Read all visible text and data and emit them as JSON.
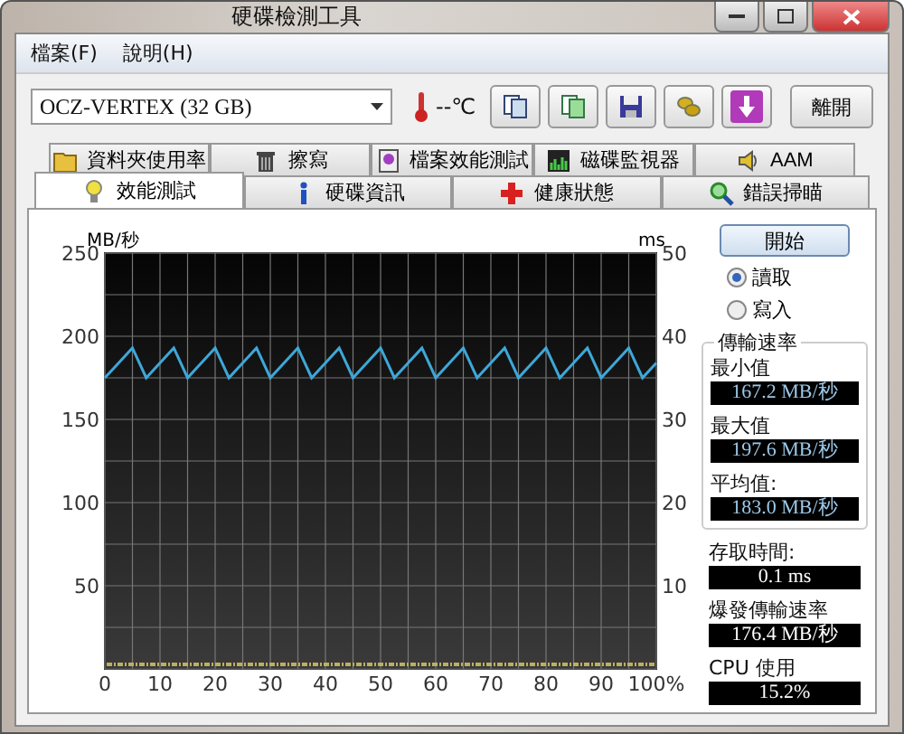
{
  "window": {
    "title": "硬碟檢測工具"
  },
  "menu": [
    {
      "label": "檔案(F)"
    },
    {
      "label": "說明(H)"
    }
  ],
  "toolbar": {
    "drive": "OCZ-VERTEX (32 GB)",
    "temperature": "--℃",
    "exit_button": "離開"
  },
  "tab_rows": [
    {
      "tabs": [
        {
          "label": "資料夾使用率",
          "kind": "folder",
          "selected": false
        },
        {
          "label": "擦寫",
          "kind": "trash",
          "selected": false
        },
        {
          "label": "檔案效能測試",
          "kind": "file",
          "selected": false
        },
        {
          "label": "磁碟監視器",
          "kind": "monitor",
          "selected": false
        },
        {
          "label": "AAM",
          "kind": "speaker",
          "selected": false
        }
      ]
    },
    {
      "tabs": [
        {
          "label": "效能測試",
          "kind": "bulb",
          "selected": true
        },
        {
          "label": "硬碟資訊",
          "kind": "info",
          "selected": false
        },
        {
          "label": "健康狀態",
          "kind": "health",
          "selected": false
        },
        {
          "label": "錯誤掃瞄",
          "kind": "search",
          "selected": false
        }
      ]
    }
  ],
  "benchmark": {
    "chart_data": {
      "type": "line",
      "ylabel": "MB/秒",
      "x": [
        0,
        2.5,
        5,
        7.5,
        10,
        12.5,
        15,
        17.5,
        20,
        22.5,
        25,
        27.5,
        30,
        32.5,
        35,
        37.5,
        40,
        42.5,
        45,
        47.5,
        50,
        52.5,
        55,
        57.5,
        60,
        62.5,
        65,
        67.5,
        70,
        72.5,
        75,
        77.5,
        80,
        82.5,
        85,
        87.5,
        90,
        92.5,
        95,
        97.5,
        100
      ],
      "series": [
        {
          "color": "#3ea7d8",
          "values": [
            175,
            184,
            193,
            175,
            184,
            193,
            175,
            184,
            193,
            175,
            184,
            193,
            175,
            184,
            193,
            175,
            184,
            193,
            175,
            184,
            193,
            175,
            184,
            193,
            175,
            184,
            193,
            175,
            184,
            193,
            175,
            184,
            193,
            175,
            184,
            193,
            175,
            184,
            193,
            175,
            184
          ]
        }
      ],
      "xlim": [
        0,
        100
      ],
      "ylim": [
        0,
        250
      ],
      "xticks": [
        0,
        10,
        20,
        30,
        40,
        50,
        60,
        70,
        80,
        90,
        {
          "value": 100,
          "label": "100%"
        }
      ],
      "yticks": [
        50,
        100,
        150,
        200,
        250
      ],
      "grid": true
    },
    "right_axis": {
      "label": "ms",
      "ticks": [
        "50",
        "40",
        "30",
        "20",
        "10"
      ]
    },
    "start_button": "開始",
    "modes": [
      {
        "label": "讀取",
        "selected": true
      },
      {
        "label": "寫入",
        "selected": false
      }
    ],
    "transfer_rate": {
      "title": "傳輸速率",
      "stats": [
        {
          "label": "最小值",
          "value": "167.2 MB/秒"
        },
        {
          "label": "最大值",
          "value": "197.6 MB/秒"
        },
        {
          "label": "平均值:",
          "value": "183.0 MB/秒"
        }
      ]
    },
    "readouts": [
      {
        "label": "存取時間:",
        "value": "0.1 ms"
      },
      {
        "label": "爆發傳輸速率",
        "value": "176.4 MB/秒"
      },
      {
        "label": "CPU 使用",
        "value": "15.2%"
      }
    ]
  }
}
